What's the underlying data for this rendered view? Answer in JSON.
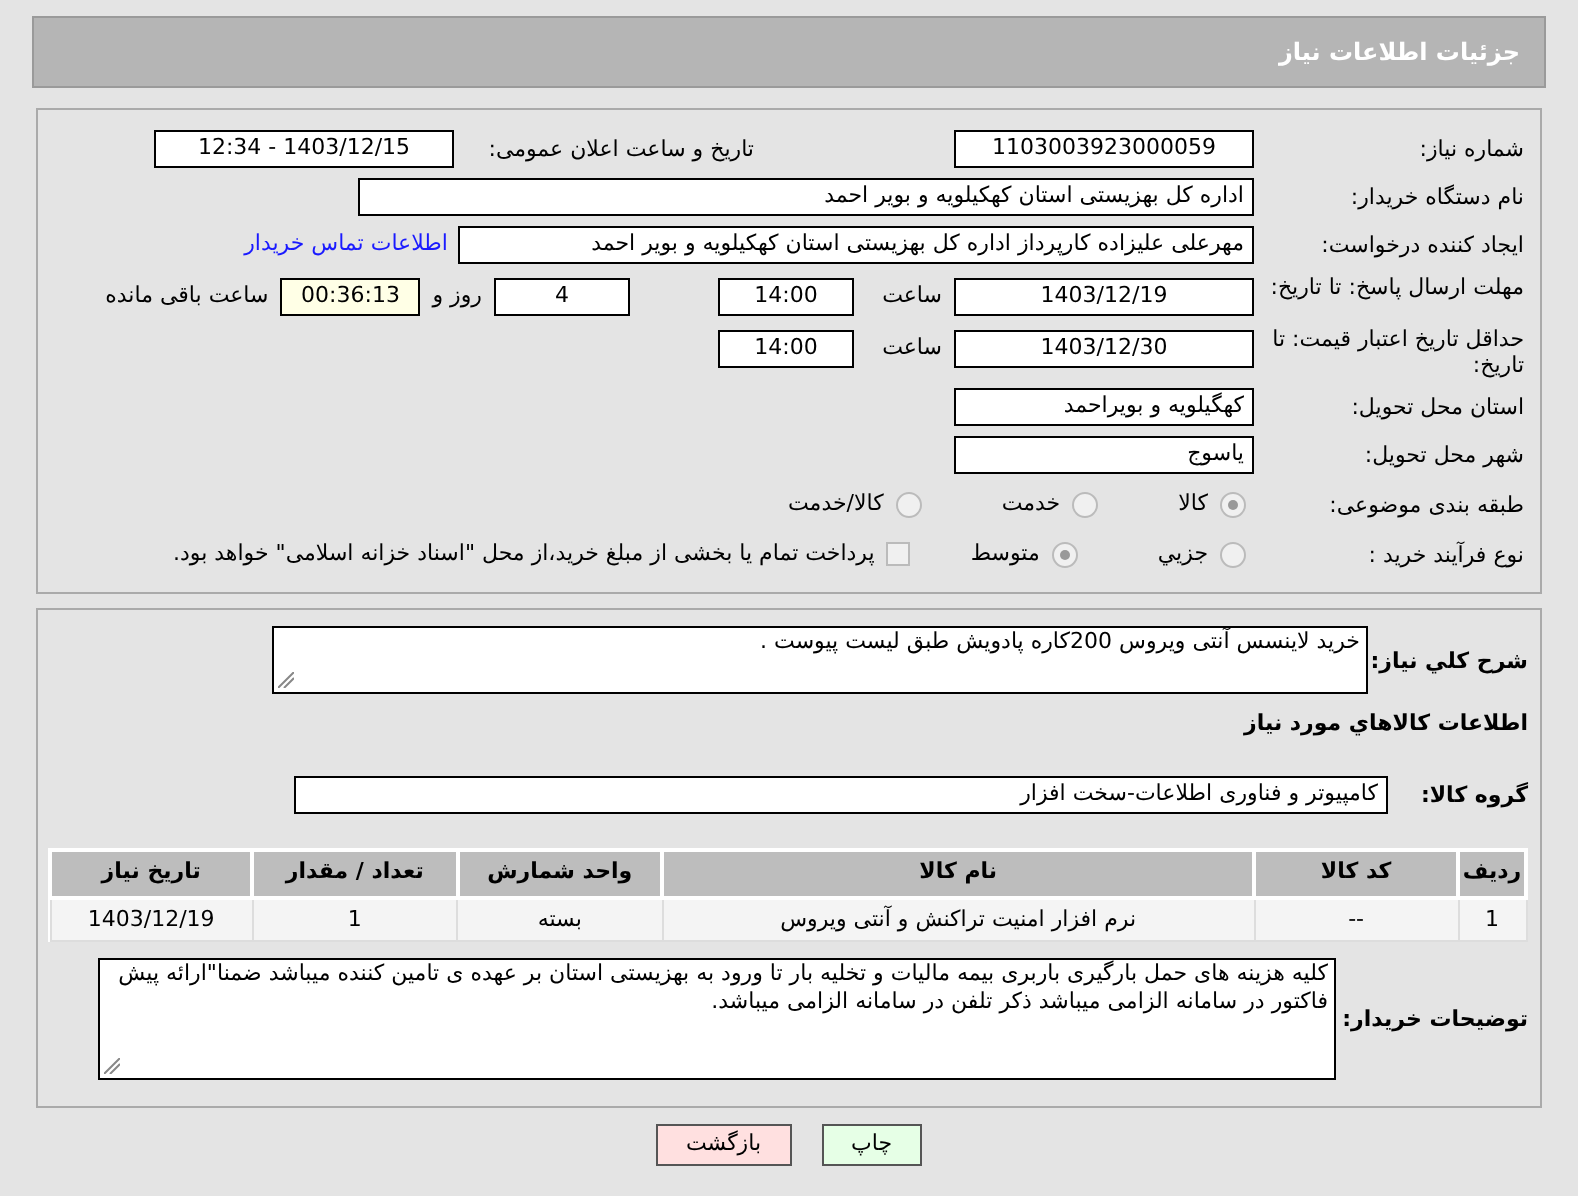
{
  "header": {
    "title": "جزئیات اطلاعات نیاز"
  },
  "need_info": {
    "need_number": {
      "label": "شماره نیاز:",
      "value": "1103003923000059"
    },
    "announce": {
      "label": "تاریخ و ساعت اعلان عمومی:",
      "value": "1403/12/15 - 12:34"
    },
    "buyer_org": {
      "label": "نام دستگاه خریدار:",
      "value": "اداره کل بهزیستی استان کهکیلویه و بویر احمد"
    },
    "requester": {
      "label": "ایجاد کننده درخواست:",
      "value": "مهرعلی علیزاده کارپرداز اداره کل بهزیستی استان کهکیلویه و بویر احمد",
      "link": "اطلاعات تماس خریدار"
    },
    "reply_deadline": {
      "label": "مهلت ارسال پاسخ: تا تاریخ:",
      "date": "1403/12/19",
      "time_label": "ساعت",
      "time": "14:00",
      "days": "4",
      "days_label": "روز و",
      "remaining": "00:36:13",
      "remaining_label": "ساعت باقی مانده"
    },
    "price_validity": {
      "label": "حداقل تاریخ اعتبار قیمت: تا تاریخ:",
      "date": "1403/12/30",
      "time_label": "ساعت",
      "time": "14:00"
    },
    "province": {
      "label": "استان محل تحویل:",
      "value": "کهگیلویه و بویراحمد"
    },
    "city": {
      "label": "شهر محل تحویل:",
      "value": "یاسوج"
    },
    "category": {
      "label": "طبقه بندی موضوعی:",
      "options": [
        {
          "label": "کالا",
          "selected": true
        },
        {
          "label": "خدمت",
          "selected": false
        },
        {
          "label": "کالا/خدمت",
          "selected": false
        }
      ]
    },
    "process": {
      "label": "نوع فرآیند خرید :",
      "options": [
        {
          "label": "جزیي",
          "selected": false
        },
        {
          "label": "متوسط",
          "selected": true
        }
      ],
      "payment": {
        "checked": false,
        "label": "پرداخت تمام یا بخشی از مبلغ خرید،از محل \"اسناد خزانه اسلامی\" خواهد بود."
      }
    }
  },
  "goods": {
    "summary": {
      "label": "شرح کلي نیاز:",
      "value": "خرید لاینسس آنتی ویروس 200کاره پادویش طبق لیست پیوست ."
    },
    "heading": "اطلاعات کالاهاي مورد نیاز",
    "group": {
      "label": "گروه کالا:",
      "value": "کامپیوتر و فناوری اطلاعات-سخت افزار"
    },
    "table": {
      "columns": [
        "ردیف",
        "کد کالا",
        "نام کالا",
        "واحد شمارش",
        "تعداد / مقدار",
        "تاریخ نیاز"
      ],
      "rows": [
        [
          "1",
          "--",
          "نرم افزار امنیت تراکنش و آنتی ویروس",
          "بسته",
          "1",
          "1403/12/19"
        ]
      ]
    },
    "notes": {
      "label": "توضیحات خریدار:",
      "value": "کلیه هزینه های حمل بارگیری  باربری بیمه مالیات و تخلیه بار تا ورود به بهزیستی استان بر عهده ی تامین کننده میباشد ضمنا\"ارائه پیش فاکتور در سامانه الزامی میباشد ذکر تلفن در سامانه الزامی میباشد."
    }
  },
  "buttons": [
    {
      "label": "چاپ",
      "kind": "print"
    },
    {
      "label": "بازگشت",
      "kind": "back"
    }
  ]
}
